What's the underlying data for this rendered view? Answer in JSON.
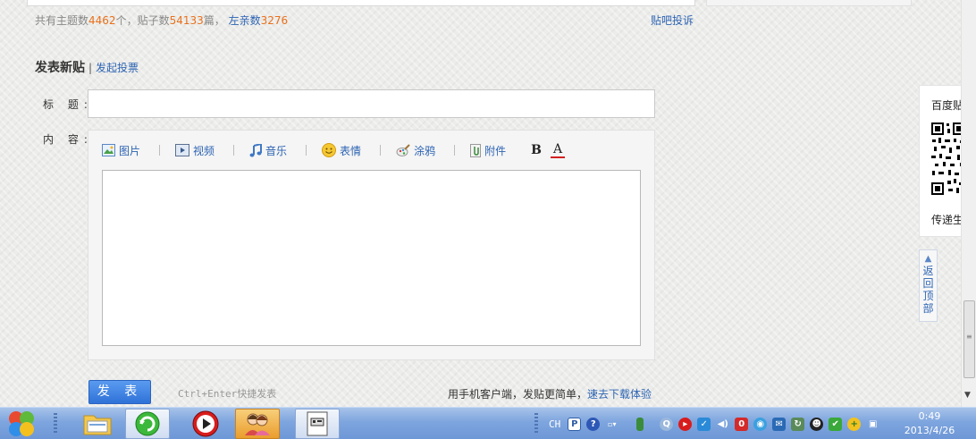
{
  "stats": {
    "topics_label": "共有主题数",
    "topics_count": "4462",
    "topics_unit": "个，贴子数",
    "posts_count": "54133",
    "posts_unit": "篇，",
    "members_label": "左亲数",
    "members_count": "3276"
  },
  "complaint_link": "贴吧投诉",
  "post_form": {
    "heading": "发表新贴",
    "separator": "|",
    "vote_link": "发起投票",
    "title_label": "标  题:",
    "title_value": "",
    "content_label": "内  容:",
    "toolbar": {
      "image": "图片",
      "video": "视频",
      "music": "音乐",
      "emoji": "表情",
      "doodle": "涂鸦",
      "attachment": "附件",
      "bold": "B",
      "font_color": "A"
    },
    "submit_label": "发 表",
    "shortcut_hint": "Ctrl+Enter快捷发表",
    "mobile_text": "用手机客户端，发贴更简单，",
    "mobile_link": "速去下载体验"
  },
  "side_panel": {
    "qr_title": "百度贴",
    "qr_caption": "传递生",
    "back_to_top": "返回顶部"
  },
  "taskbar": {
    "lang": "CH",
    "clock_time": "0:49",
    "clock_date": "2013/4/26"
  }
}
